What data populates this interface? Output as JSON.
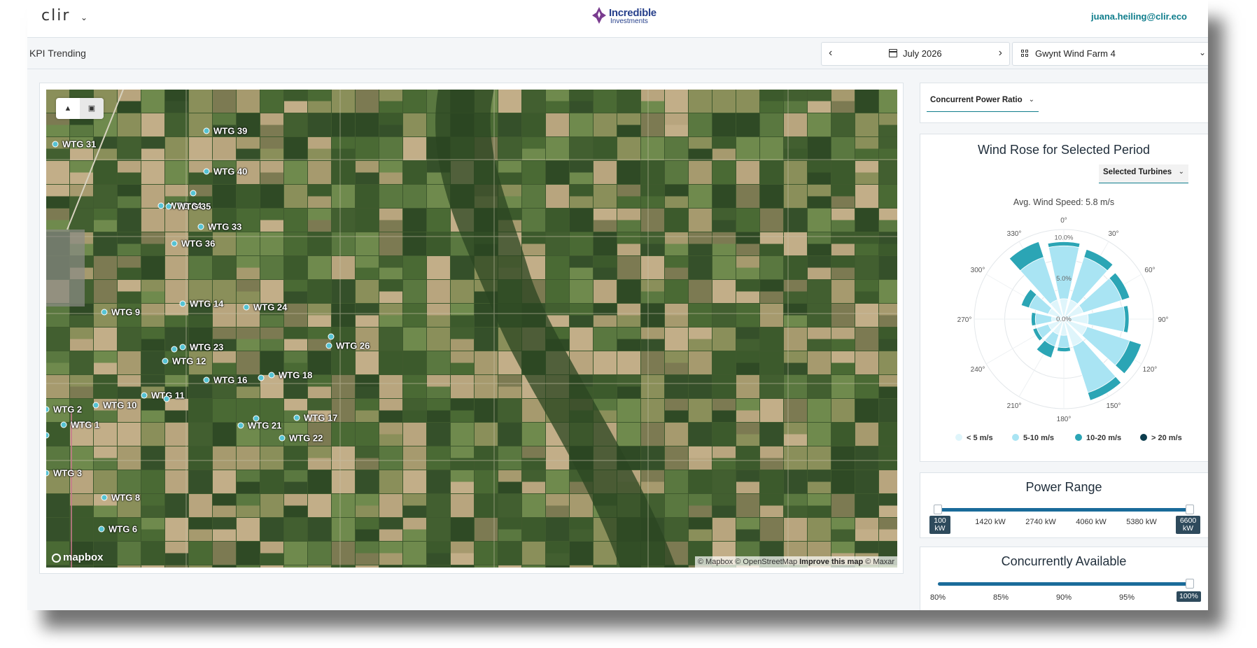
{
  "header": {
    "brand": "clir",
    "logo_line1": "Incredible",
    "logo_line2": "Investments",
    "user_email": "juana.heiling@clir.eco"
  },
  "subheader": {
    "page_title": "KPI Trending",
    "date": "July 2026",
    "farm": "Gwynt Wind Farm 4"
  },
  "map": {
    "attribution_prefix": "© Mapbox © OpenStreetMap",
    "attribution_link": "Improve this map",
    "attribution_suffix": "© Maxar",
    "mapbox_logo": "mapbox",
    "style_buttons": [
      "terrain-icon",
      "satellite-icon"
    ],
    "turbine_color": "#56c3d3",
    "turbines": [
      {
        "label": "WTG 39"
      },
      {
        "label": "WTG 31"
      },
      {
        "label": "WTG 40"
      },
      {
        "label": "WTG 34"
      },
      {
        "label": "WTG 35"
      },
      {
        "label": "WTG 33"
      },
      {
        "label": "WTG 36"
      },
      {
        "label": "WTG 14"
      },
      {
        "label": "WTG 24"
      },
      {
        "label": "WTG 9"
      },
      {
        "label": "WTG 26"
      },
      {
        "label": "WTG 23"
      },
      {
        "label": "WTG 12"
      },
      {
        "label": "WTG 16"
      },
      {
        "label": "WTG 18"
      },
      {
        "label": "WTG 11"
      },
      {
        "label": "WTG 2"
      },
      {
        "label": "WTG 10"
      },
      {
        "label": "WTG 17"
      },
      {
        "label": "WTG 1"
      },
      {
        "label": "WTG 21"
      },
      {
        "label": "WTG 22"
      },
      {
        "label": "WTG 3"
      },
      {
        "label": "WTG 8"
      },
      {
        "label": "WTG 6"
      }
    ]
  },
  "kpi_selector": {
    "label": "Concurrent Power Ratio"
  },
  "wind_rose": {
    "title": "Wind Rose for Selected Period",
    "turbine_filter": "Selected Turbines",
    "avg_speed": "Avg. Wind Speed: 5.8 m/s",
    "direction_labels": [
      "0°",
      "30°",
      "60°",
      "90°",
      "120°",
      "150°",
      "180°",
      "210°",
      "240°",
      "270°",
      "300°",
      "330°"
    ],
    "radial_labels": [
      "0.0%",
      "5.0%",
      "10.0%"
    ],
    "legend": [
      {
        "label": "< 5 m/s",
        "color": "#dff5fb"
      },
      {
        "label": "5-10 m/s",
        "color": "#a9e4f3"
      },
      {
        "label": "10-20 m/s",
        "color": "#2ba5b5"
      },
      {
        "label": "> 20 m/s",
        "color": "#0b3c4d"
      }
    ]
  },
  "chart_data": {
    "type": "wind_rose",
    "title": "Wind Rose for Selected Period",
    "radial_max_percent": 11,
    "radial_ticks": [
      0,
      5,
      10
    ],
    "series": [
      {
        "name": "< 5 m/s",
        "values": [
          2.5,
          2.5,
          2.5,
          3.0,
          3.0,
          3.5,
          2.0,
          2.0,
          2.0,
          1.5,
          2.0,
          2.5
        ]
      },
      {
        "name": "5-10 m/s",
        "values": [
          6.5,
          5.5,
          5.0,
          4.5,
          5.5,
          6.0,
          1.5,
          1.5,
          1.5,
          2.0,
          2.5,
          5.5
        ]
      },
      {
        "name": "10-20 m/s",
        "values": [
          0.5,
          1.0,
          1.0,
          0.5,
          1.5,
          1.0,
          0.5,
          1.5,
          0.5,
          0.5,
          1.0,
          2.0
        ]
      },
      {
        "name": "> 20 m/s",
        "values": [
          0,
          0,
          0,
          0,
          0,
          0,
          0,
          0,
          0,
          0,
          0,
          0
        ]
      }
    ],
    "directions": [
      "0°",
      "30°",
      "60°",
      "90°",
      "120°",
      "150°",
      "180°",
      "210°",
      "240°",
      "270°",
      "300°",
      "330°"
    ]
  },
  "power_range": {
    "title": "Power Range",
    "ticks": [
      "1420 kW",
      "2740 kW",
      "4060 kW",
      "5380 kW"
    ],
    "min_label": "100\nkW",
    "max_label": "6600\nkW",
    "selected_min_kw": 100,
    "selected_max_kw": 6600
  },
  "concurrently_available": {
    "title": "Concurrently Available",
    "ticks": [
      "80%",
      "85%",
      "90%",
      "95%"
    ],
    "value_label": "100%",
    "value_percent": 100
  }
}
